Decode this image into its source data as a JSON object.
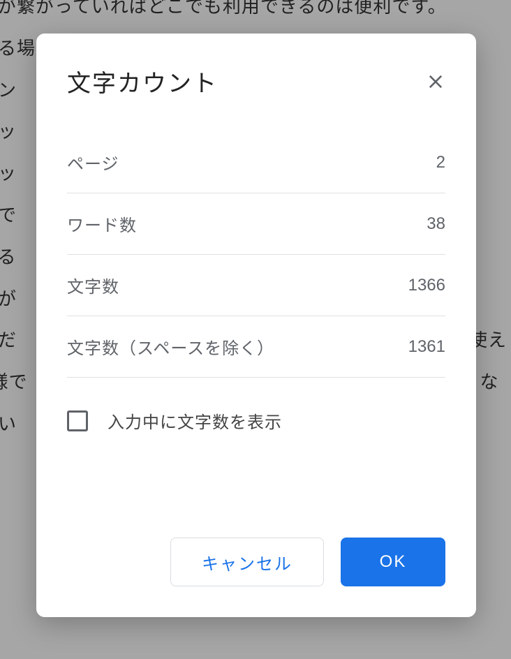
{
  "background": {
    "lines": [
      "トが繋がっていればどこでも利用できるのは便利です。",
      "ある場所に依存しますから",
      "",
      "メン",
      "",
      "リッ",
      "リッ",
      "",
      "用で",
      "",
      "",
      "きる",
      "成が",
      "覧だ　　　　　　　　　　　　　　　　　　　　　　　　使え",
      "e様で　　　　　　　　　　　　　　　　　　　　　　　うな",
      "ない"
    ]
  },
  "dialog": {
    "title": "文字カウント",
    "stats": {
      "pages": {
        "label": "ページ",
        "value": "2"
      },
      "words": {
        "label": "ワード数",
        "value": "38"
      },
      "chars": {
        "label": "文字数",
        "value": "1366"
      },
      "chars_no_spaces": {
        "label": "文字数（スペースを除く）",
        "value": "1361"
      }
    },
    "checkbox_label": "入力中に文字数を表示",
    "actions": {
      "cancel": "キャンセル",
      "ok": "OK"
    }
  }
}
